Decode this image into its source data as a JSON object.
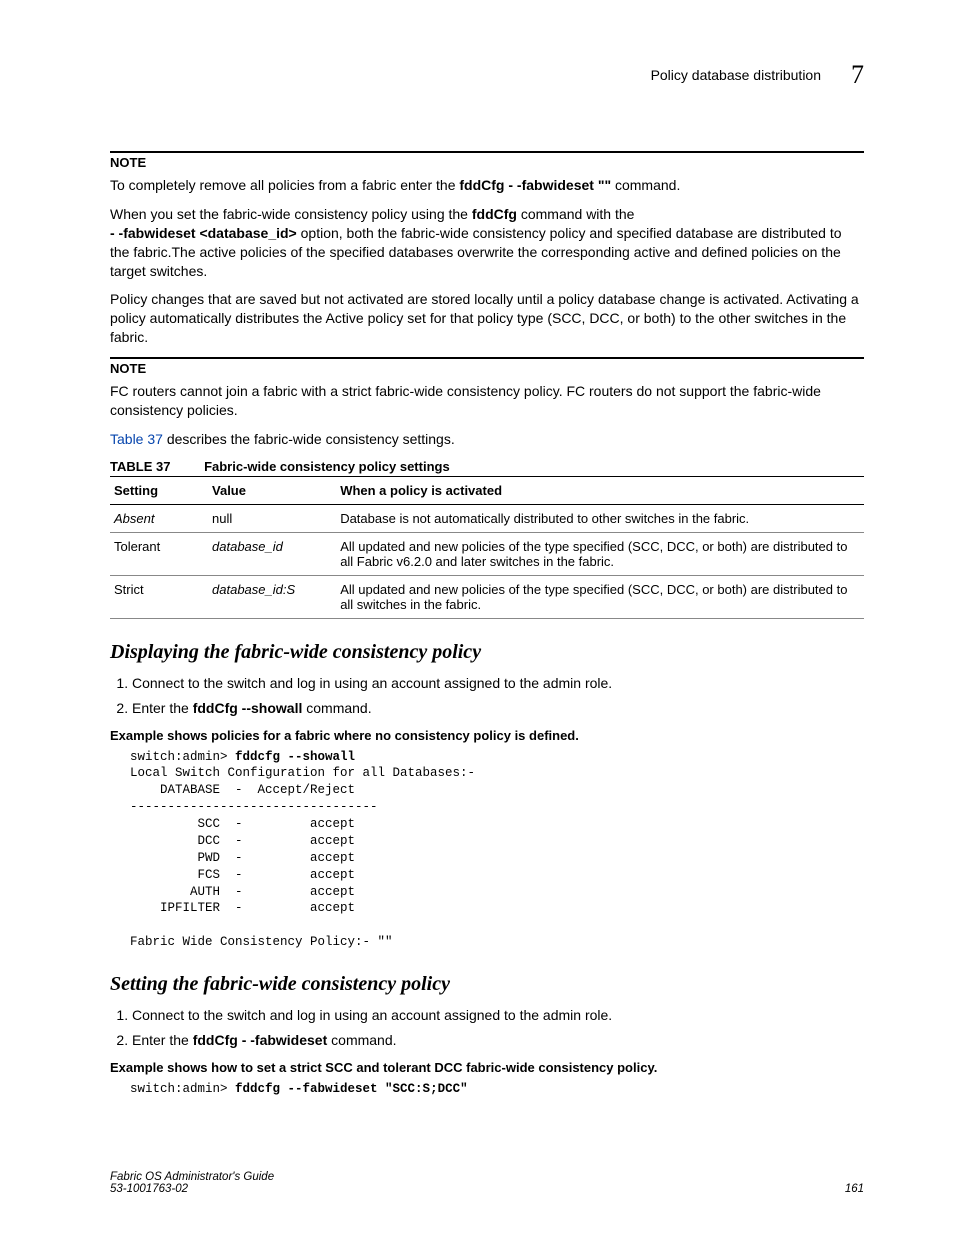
{
  "header": {
    "section_title": "Policy database distribution",
    "chapter_number": "7"
  },
  "notes": {
    "label": "NOTE",
    "note1_prefix": "To completely remove all policies from a fabric enter the ",
    "note1_cmd1": "fddCfg",
    "note1_opt": "- -fabwideset \"\"",
    "note1_suffix": " command.",
    "note2_line1": "FC routers cannot join a fabric with a strict fabric-wide consistency policy. FC routers do not support the fabric-wide consistency policies."
  },
  "paras": {
    "p1_a": "When you set the fabric-wide consistency policy using the ",
    "p1_cmd": "fddCfg",
    "p1_b": " command with the ",
    "p1_opt": "- -fabwideset <database_id>",
    "p1_c": " option, both the fabric-wide consistency policy and specified database are distributed to the fabric.The active policies of the specified databases overwrite the corresponding active and defined policies on the target switches.",
    "p2": "Policy changes that are saved but not activated are stored locally until a policy database change is activated. Activating a policy automatically distributes the Active policy set for that policy type (SCC, DCC, or both) to the other switches in the fabric.",
    "p3_link": "Table 37",
    "p3_rest": " describes the fabric-wide consistency settings."
  },
  "table": {
    "label": "TABLE 37",
    "caption": "Fabric-wide consistency policy settings",
    "headers": {
      "c1": "Setting",
      "c2": "Value",
      "c3": "When a policy is activated"
    },
    "rows": [
      {
        "c1": "Absent",
        "c2": "null",
        "c3": "Database is not automatically distributed to other switches in the fabric."
      },
      {
        "c1": "Tolerant",
        "c2": "database_id",
        "c3": "All updated and new policies of the type specified (SCC, DCC, or both) are distributed to all Fabric v6.2.0 and later switches in the fabric."
      },
      {
        "c1": "Strict",
        "c2": "database_id:S",
        "c3": "All updated and new policies of the type specified (SCC, DCC, or both) are distributed to all switches in the fabric."
      }
    ]
  },
  "sections": {
    "display": {
      "title": "Displaying the fabric-wide consistency policy",
      "steps": {
        "s1": "Connect to the switch and log in using an account assigned to the admin role.",
        "s2_a": "Enter the ",
        "s2_cmd": "fddCfg --showall",
        "s2_b": " command."
      },
      "example_label": "Example  shows policies for a fabric where no consistency policy is defined.",
      "code_prompt": "switch:admin> ",
      "code_cmd": "fddcfg --showall",
      "code_body_line1": "Local Switch Configuration for all Databases:-",
      "code_body_line2": "    DATABASE  -  Accept/Reject",
      "code_body_line3": "---------------------------------",
      "code_body_line4": "         SCC  -         accept",
      "code_body_line5": "         DCC  -         accept",
      "code_body_line6": "         PWD  -         accept",
      "code_body_line7": "         FCS  -         accept",
      "code_body_line8": "        AUTH  -         accept",
      "code_body_line9": "    IPFILTER  -         accept",
      "code_body_line10": "",
      "code_body_line11": "Fabric Wide Consistency Policy:- \"\""
    },
    "setting": {
      "title": "Setting the fabric-wide consistency policy",
      "steps": {
        "s1": "Connect to the switch and log in using an account assigned to the admin role.",
        "s2_a": "Enter the ",
        "s2_cmd1": "fddCfg",
        "s2_opt": "- -fabwideset",
        "s2_b": " command."
      },
      "example_label": "Example  shows how to set a strict SCC and tolerant DCC fabric-wide consistency policy.",
      "code_prompt": "switch:admin> ",
      "code_cmd": "fddcfg --fabwideset \"SCC:S;DCC\""
    }
  },
  "footer": {
    "left_line1": "Fabric OS Administrator's Guide",
    "left_line2": "53-1001763-02",
    "page_number": "161"
  }
}
